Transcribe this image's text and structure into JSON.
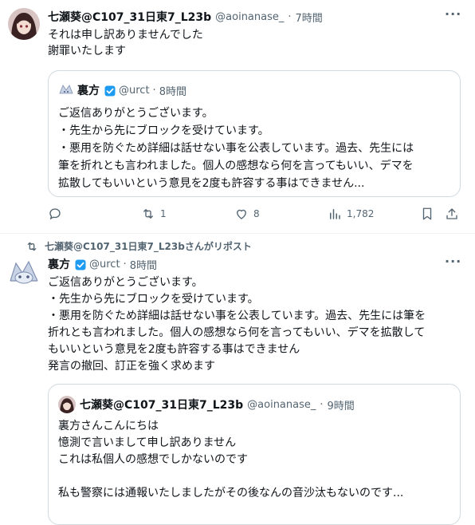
{
  "tweet1": {
    "author_name": "七瀬葵@C107_31日東7_L23b",
    "handle": "@aoinanase_",
    "sep": "·",
    "time": "7時間",
    "text_lines": [
      "それは申し訳ありませんでした",
      "謝罪いたします"
    ],
    "quote": {
      "author_name": "裏方",
      "handle": "@urct",
      "sep": "·",
      "time": "8時間",
      "text_lines": [
        "ご返信ありがとうございます。",
        "・先生から先にブロックを受けています。",
        "・悪用を防ぐため詳細は話せない事を公表しています。過去、先生には",
        "筆を折れとも言われました。個人の感想なら何を言ってもいい、デマを",
        "拡散してもいいという意見を2度も許容する事はできません..."
      ]
    },
    "actions": {
      "reply_count": "",
      "retweet_count": "1",
      "like_count": "8",
      "views_count": "1,782"
    }
  },
  "tweet2": {
    "repost_text": "七瀬葵@C107_31日東7_L23bさんがリポスト",
    "author_name": "裏方",
    "handle": "@urct",
    "sep": "·",
    "time": "8時間",
    "text_lines": [
      "ご返信ありがとうございます。",
      "・先生から先にブロックを受けています。",
      "・悪用を防ぐため詳細は話せない事を公表しています。過去、先生には筆を",
      "折れとも言われました。個人の感想なら何を言ってもいい、デマを拡散して",
      "もいいという意見を2度も許容する事はできません",
      "発言の撤回、訂正を強く求めます"
    ],
    "quote": {
      "author_name": "七瀬葵@C107_31日東7_L23b",
      "handle": "@aoinanase_",
      "sep": "·",
      "time": "9時間",
      "text_lines": [
        "裏方さんこんにちは",
        "憶測で言いまして申し訳ありません",
        "これは私個人の感想でしかないのです",
        "",
        "私も警察には通報いたしましたがその後なんの音沙汰もないのです..."
      ]
    }
  },
  "colors": {
    "verified": "#1d9bf0",
    "muted": "#536471",
    "border": "#cfd9de"
  }
}
